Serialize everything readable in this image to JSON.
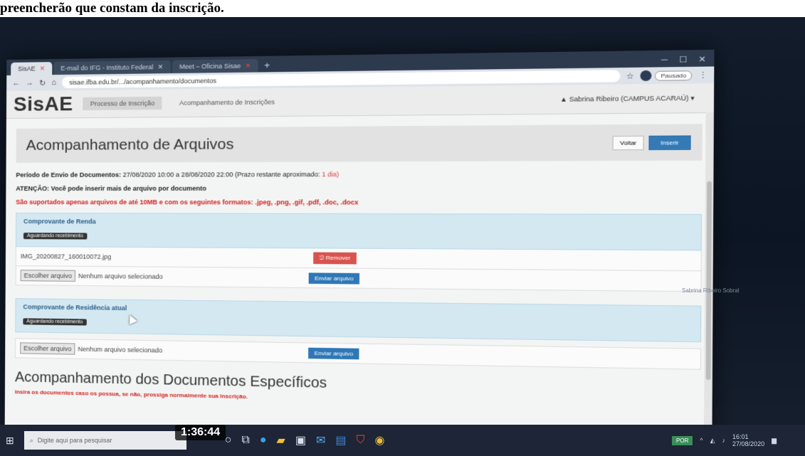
{
  "caption": "preencherão que constam da inscrição.",
  "video_timestamp": "1:36:44",
  "browser": {
    "tabs": [
      {
        "label": "SisAE",
        "active": true
      },
      {
        "label": "E-mail do IFG - Instituto Federal",
        "active": false
      },
      {
        "label": "Meet – Oficina Sisae",
        "active": false
      }
    ],
    "new_tab": "+",
    "url": "sisae.ifba.edu.br/.../acompanhamento/documentos",
    "profile_label": "Pausado"
  },
  "app": {
    "brand": "SisAE",
    "nav": [
      {
        "label": "Processo de Inscrição",
        "active": true
      },
      {
        "label": "Acompanhamento de Inscrições",
        "active": false
      }
    ],
    "user": "Sabrina Ribeiro (CAMPUS ACARAÚ) ▾"
  },
  "page": {
    "title": "Acompanhamento de Arquivos",
    "btn_voltar": "Voltar",
    "btn_inserir": "Inserir",
    "period_label": "Período de Envio de Documentos:",
    "period_value": "27/08/2020 10:00 a 28/08/2020 22:00 (Prazo restante aproximado:",
    "period_remaining": "1 dia)",
    "attention_label": "ATENÇÃO:",
    "attention_text": "Você pode inserir mais de arquivo por documento",
    "formats_text": "São suportados apenas arquivos de até 10MB e com os seguintes formatos: .jpeg, .png, .gif, .pdf, .doc, .docx"
  },
  "sections": [
    {
      "title": "Comprovante de Renda",
      "status": "Aguardando recebimento",
      "file": "IMG_20200827_160010072.jpg",
      "remove_label": "Remover",
      "choose_label": "Escolher arquivo",
      "no_file": "Nenhum arquivo selecionado",
      "send_label": "Enviar arquivo"
    },
    {
      "title": "Comprovante de Residência atual",
      "status": "Aguardando recebimento",
      "choose_label": "Escolher arquivo",
      "no_file": "Nenhum arquivo selecionado",
      "send_label": "Enviar arquivo"
    }
  ],
  "specific": {
    "title": "Acompanhamento dos Documentos Específicos",
    "note": "Insira os documentos caso os possua, se não, prossiga normalmente sua inscrição."
  },
  "taskbar": {
    "search_placeholder": "Digite aqui para pesquisar",
    "lang": "POR",
    "time": "16:01",
    "date": "27/08/2020"
  },
  "side_text": "Sabrina Ribeiro Sobral"
}
